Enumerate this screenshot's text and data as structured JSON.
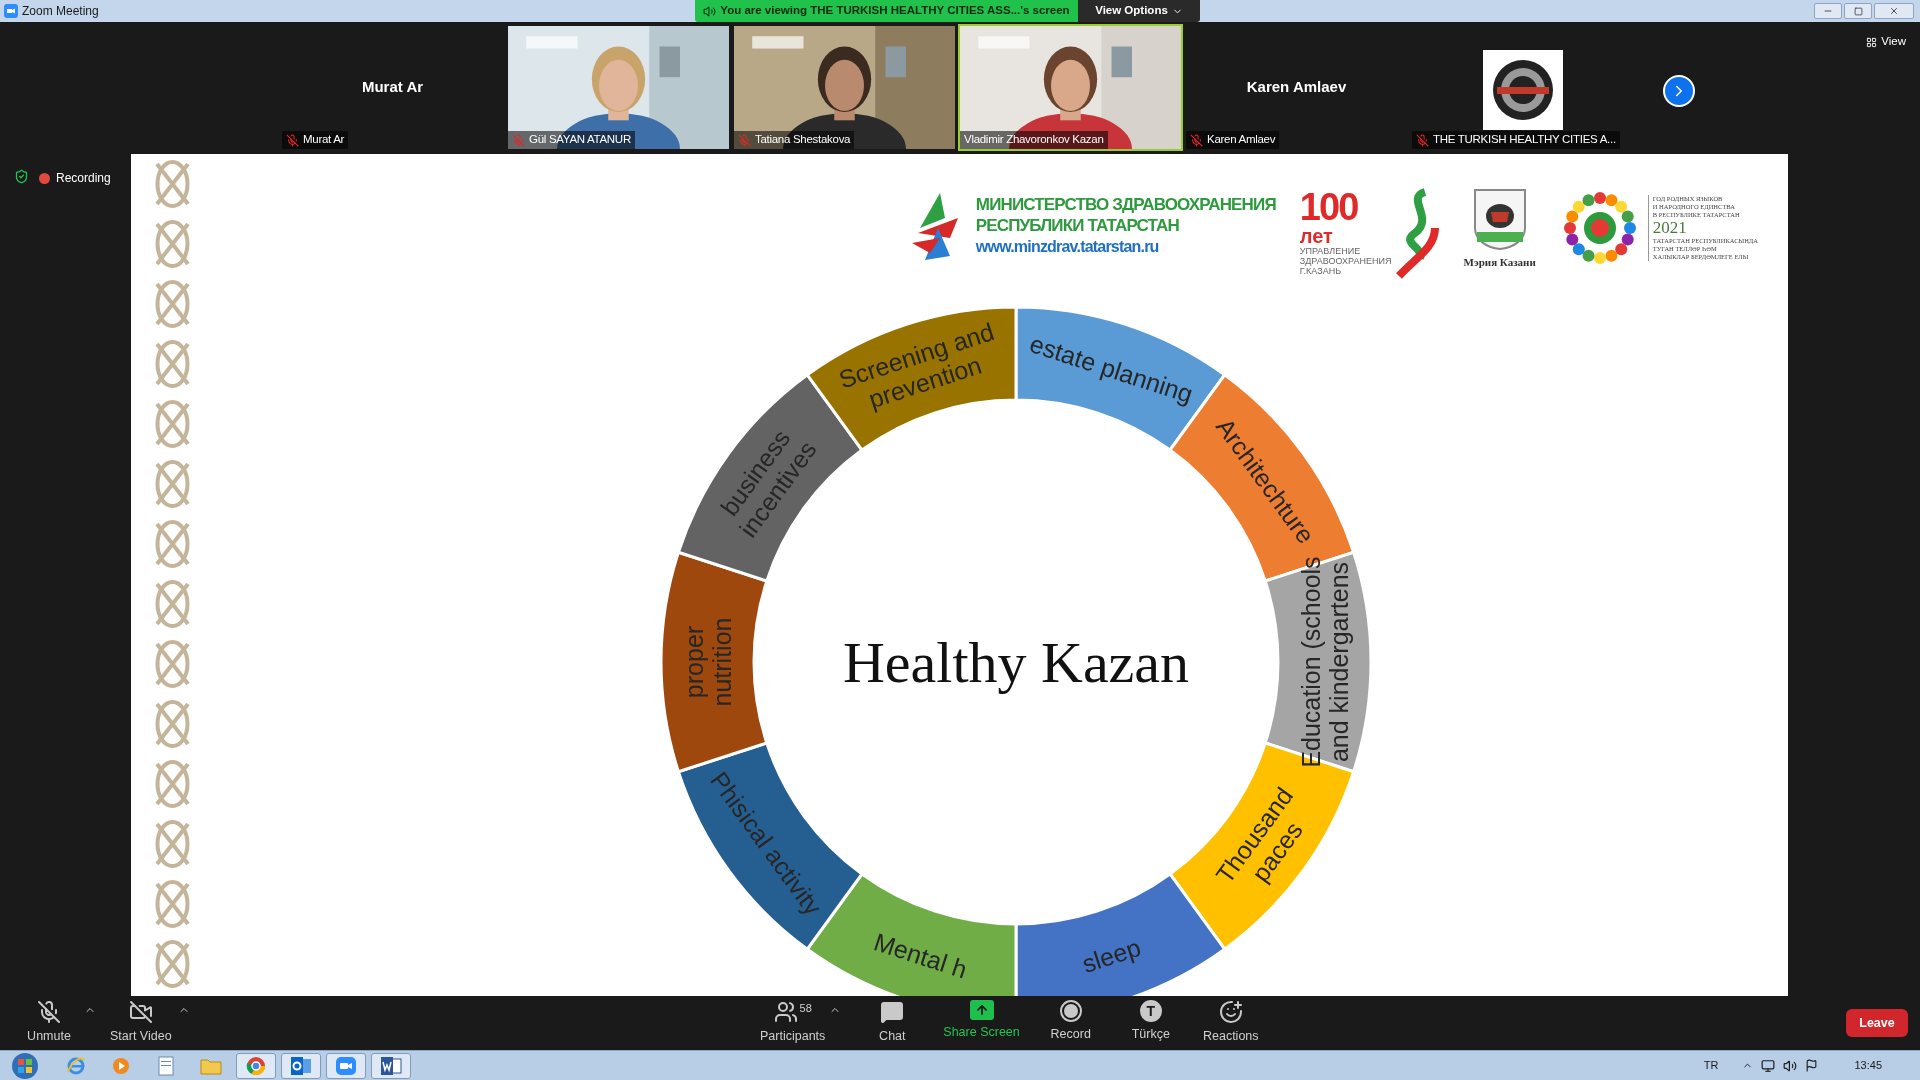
{
  "window": {
    "title": "Zoom Meeting"
  },
  "banner": {
    "text": "You are viewing THE TURKISH HEALTHY CITIES ASS...'s screen",
    "view_options": "View Options"
  },
  "participants": [
    {
      "kind": "name",
      "center_name": "Murat Ar",
      "name": "Murat Ar",
      "muted": true,
      "active": false
    },
    {
      "kind": "video",
      "name": "Gül SAYAN ATANUR",
      "muted": true,
      "active": false
    },
    {
      "kind": "video",
      "name": "Tatiana Shestakova",
      "muted": true,
      "active": false
    },
    {
      "kind": "video",
      "name": "Vladimir Zhavoronkov Kazan",
      "muted": false,
      "active": true
    },
    {
      "kind": "name",
      "center_name": "Karen Amlaev",
      "name": "Karen Amlaev",
      "muted": true,
      "active": false
    },
    {
      "kind": "logo",
      "name": "THE TURKISH HEALTHY CITIES A...",
      "muted": true,
      "active": false
    }
  ],
  "view_button": "View",
  "recording": {
    "label": "Recording",
    "on": true
  },
  "slide": {
    "ministry": {
      "lines": [
        "МИНИСТЕРСТВО ЗДРАВООХРАНЕНИЯ",
        "РЕСПУБЛИКИ ТАТАРСТАН"
      ],
      "url": "www.minzdrav.tatarstan.ru"
    },
    "anniversary": {
      "number": "100",
      "word": "лет",
      "caption": [
        "УПРАВЛЕНИЕ",
        "ЗДРАВООХРАНЕНИЯ",
        "Г.КАЗАНЬ"
      ]
    },
    "mayor": {
      "caption": "Мэрия Казани"
    },
    "year": {
      "top": [
        "ГОД РОДНЫХ ЯЗЫКОВ",
        "И НАРОДНОГО ЕДИНСТВА",
        "В РЕСПУБЛИКЕ ТАТАРСТАН"
      ],
      "year": "2021",
      "bottom": [
        "ТАТАРСТАН РЕСПУБЛИКАСЫНДА",
        "ТУГАН ТЕЛЛӘР ҺӘМ",
        "ХАЛЫКЛАР БЕРДӘМЛЕГЕ ЕЛЫ"
      ]
    },
    "diagram": {
      "title": "Healthy Kazan",
      "segments": [
        {
          "lines": [
            "estate planning"
          ],
          "color": "#5b9bd5"
        },
        {
          "lines": [
            "Architechture"
          ],
          "color": "#ed7d31"
        },
        {
          "lines": [
            "Education (schools",
            "and kindergartens"
          ],
          "color": "#a5a5a5"
        },
        {
          "lines": [
            "Thousand",
            "paces"
          ],
          "color": "#ffc000"
        },
        {
          "lines": [
            "sleep"
          ],
          "color": "#4472c4"
        },
        {
          "lines": [
            "Mental h"
          ],
          "color": "#70ad47"
        },
        {
          "lines": [
            "Phisical activity"
          ],
          "color": "#255e91"
        },
        {
          "lines": [
            "proper",
            "nutrition"
          ],
          "color": "#9e480e"
        },
        {
          "lines": [
            "business",
            "incentives"
          ],
          "color": "#636363"
        },
        {
          "lines": [
            "Screening and",
            "prevention"
          ],
          "color": "#997300"
        }
      ]
    }
  },
  "toolbar": {
    "left": [
      {
        "kind": "mic",
        "label": "Unmute"
      },
      {
        "kind": "video",
        "label": "Start Video"
      }
    ],
    "center": [
      {
        "kind": "participants",
        "label": "Participants",
        "count": "58"
      },
      {
        "kind": "chat",
        "label": "Chat"
      },
      {
        "kind": "share",
        "label": "Share Screen"
      },
      {
        "kind": "record",
        "label": "Record"
      },
      {
        "kind": "language",
        "label": "Türkçe",
        "glyph": "T"
      },
      {
        "kind": "reactions",
        "label": "Reactions"
      }
    ],
    "leave": "Leave"
  },
  "taskbar": {
    "apps": [
      {
        "kind": "ie",
        "running": false
      },
      {
        "kind": "media",
        "running": false
      },
      {
        "kind": "notes",
        "running": false
      },
      {
        "kind": "explorer",
        "running": false
      },
      {
        "kind": "chrome",
        "running": true
      },
      {
        "kind": "outlook",
        "running": true
      },
      {
        "kind": "zoom",
        "running": true
      },
      {
        "kind": "word",
        "running": true
      }
    ],
    "language": "TR",
    "clock": "13:45"
  }
}
